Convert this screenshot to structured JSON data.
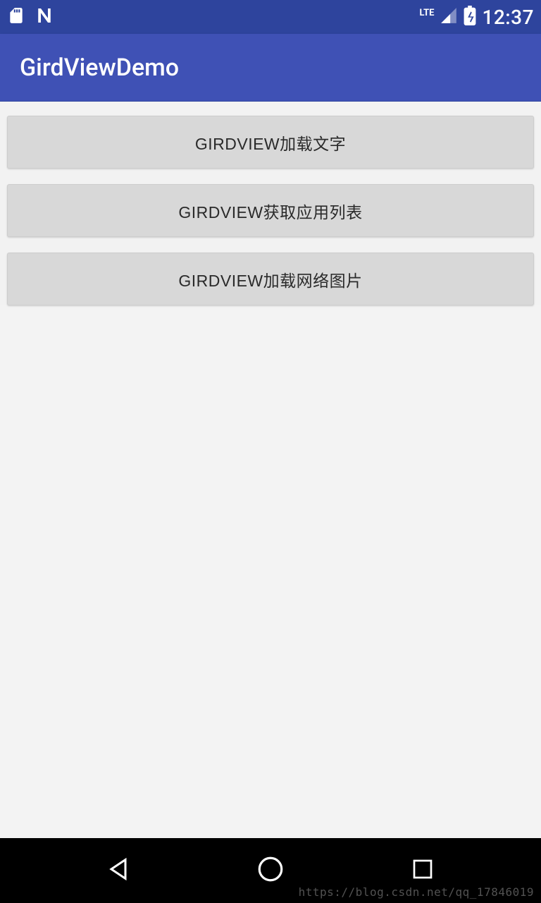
{
  "statusbar": {
    "network_label": "LTE",
    "time": "12:37"
  },
  "appbar": {
    "title": "GirdViewDemo"
  },
  "buttons": [
    {
      "label": "GIRDVIEW加载文字"
    },
    {
      "label": "GIRDVIEW获取应用列表"
    },
    {
      "label": "GIRDVIEW加载网络图片"
    }
  ],
  "watermark": "https://blog.csdn.net/qq_17846019"
}
